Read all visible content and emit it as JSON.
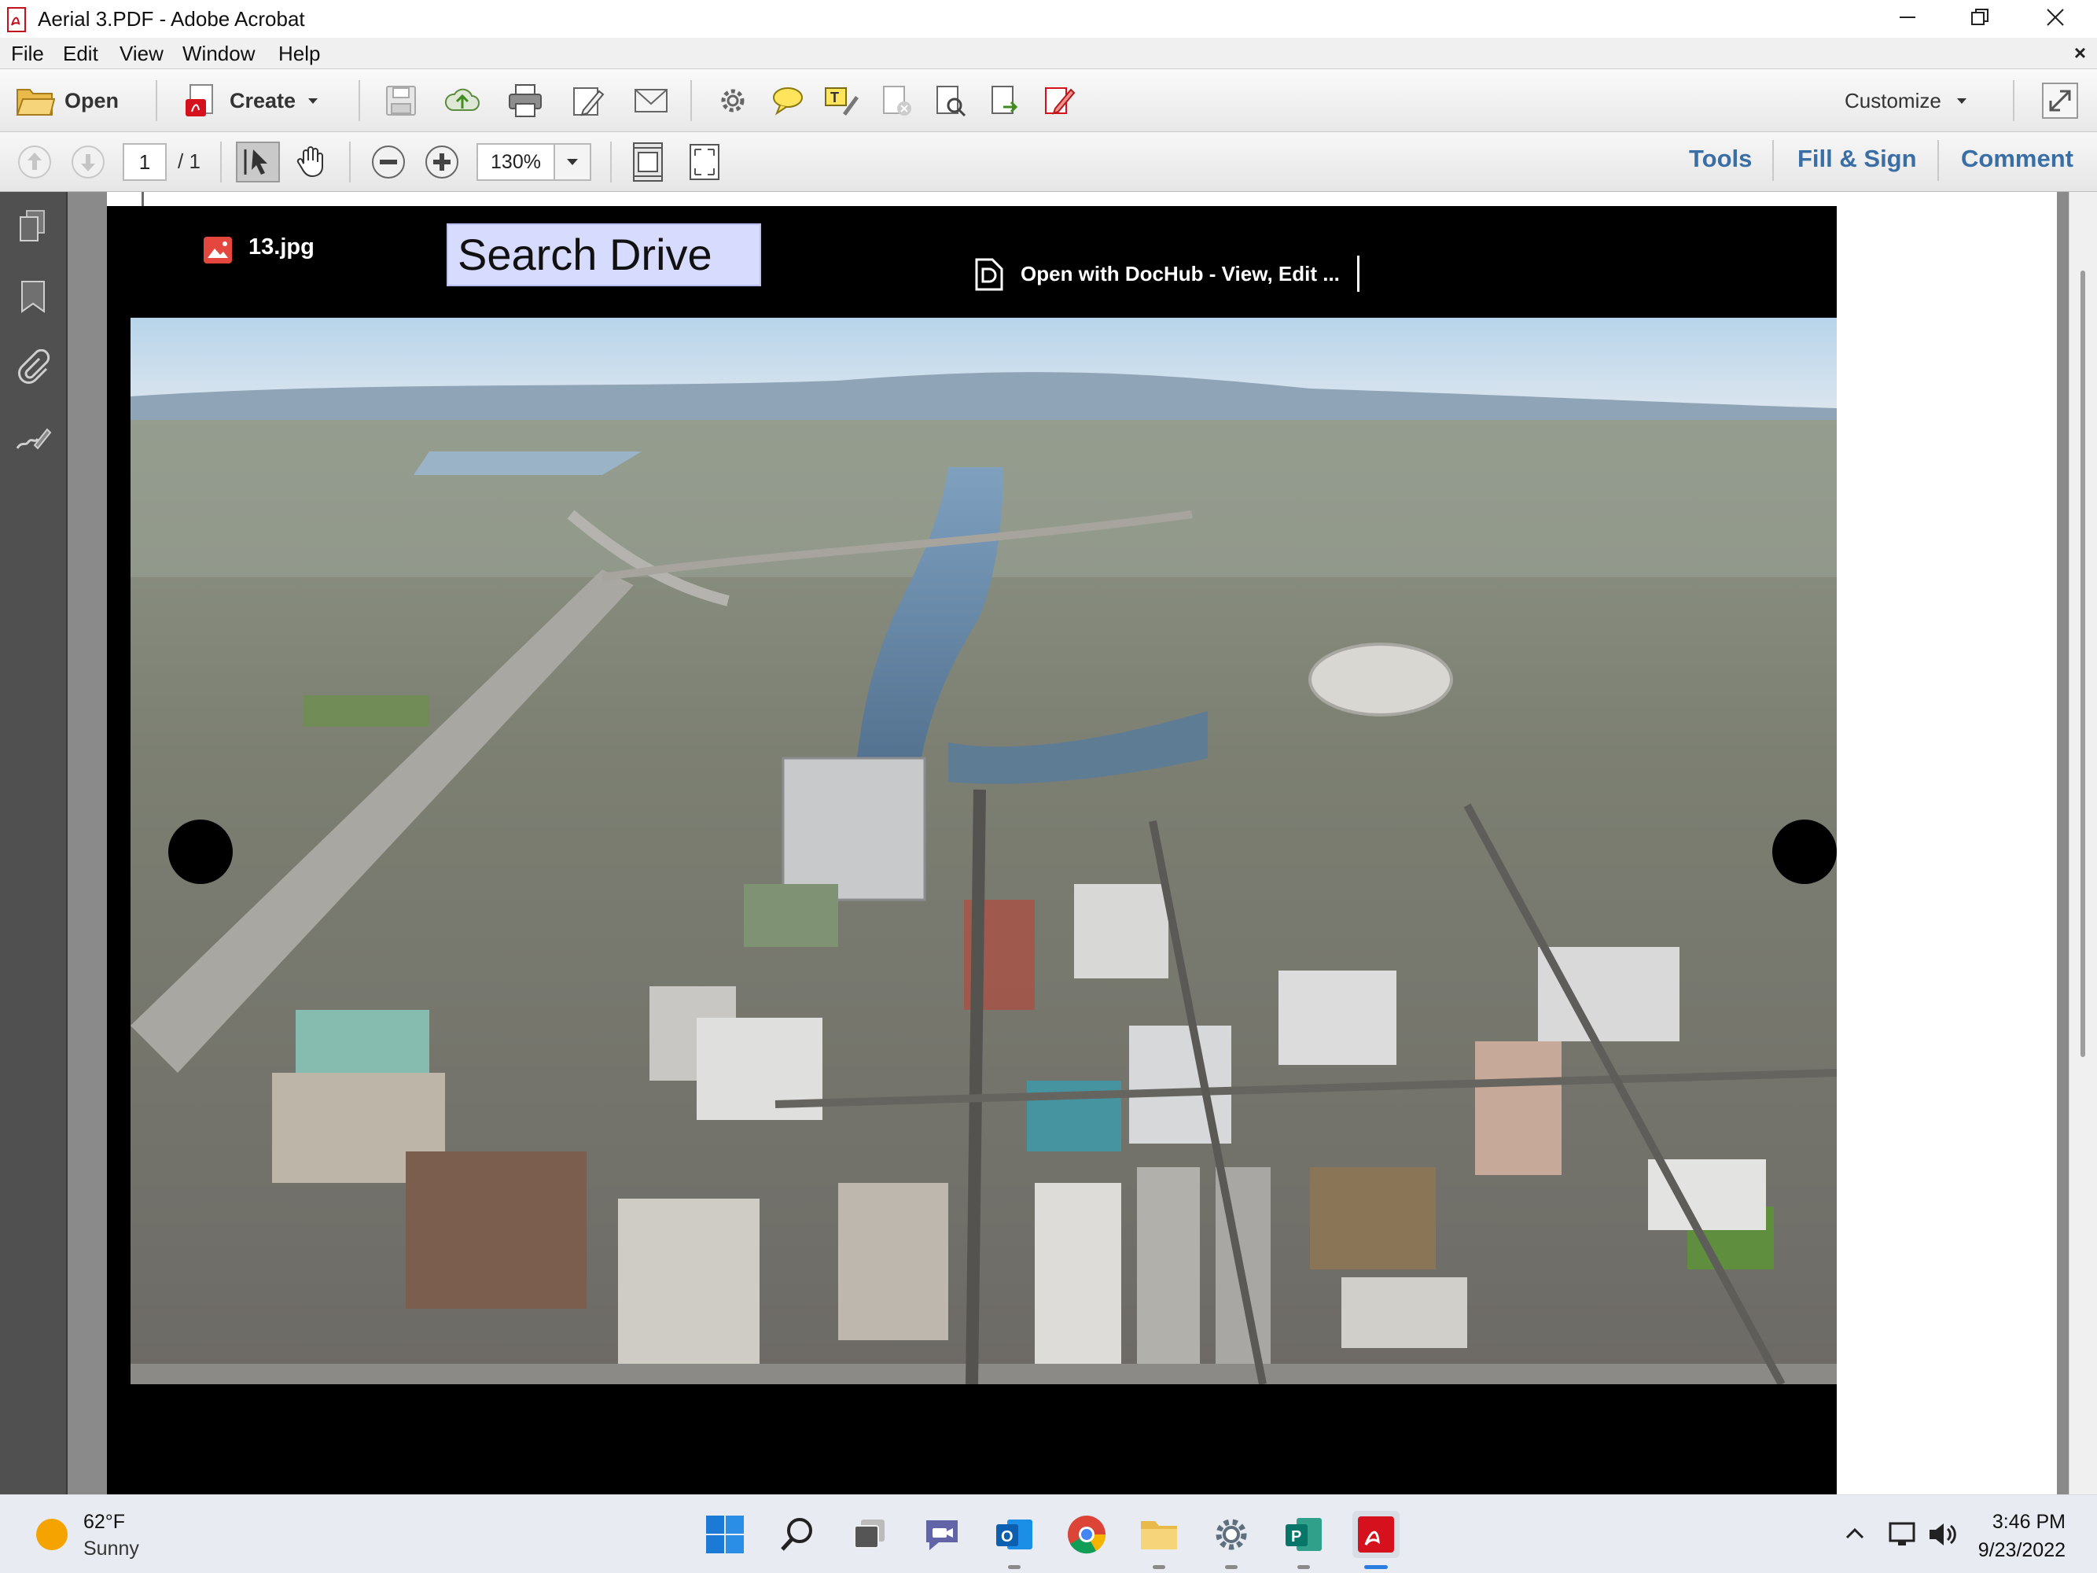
{
  "window": {
    "title": "Aerial 3.PDF - Adobe Acrobat"
  },
  "menubar": {
    "items": [
      "File",
      "Edit",
      "View",
      "Window",
      "Help"
    ],
    "close_doc": "×"
  },
  "toolbar1": {
    "open_label": "Open",
    "create_label": "Create",
    "customize_label": "Customize"
  },
  "toolbar2": {
    "page_current": "1",
    "page_total": "/ 1",
    "zoom": "130%",
    "tools_label": "Tools",
    "fill_sign_label": "Fill & Sign",
    "comment_label": "Comment"
  },
  "viewer": {
    "file_name": "13.jpg",
    "search_box_text": "Search Drive",
    "open_with_label": "Open with DocHub - View, Edit ..."
  },
  "taskbar": {
    "temperature": "62°F",
    "weather": "Sunny",
    "time": "3:46 PM",
    "date": "9/23/2022"
  },
  "colors": {
    "accent": "#3a6fa6",
    "search_box_bg": "#d7dcff",
    "acrobat_red": "#d4111c",
    "taskbar_bg": "#e8ecf2"
  }
}
